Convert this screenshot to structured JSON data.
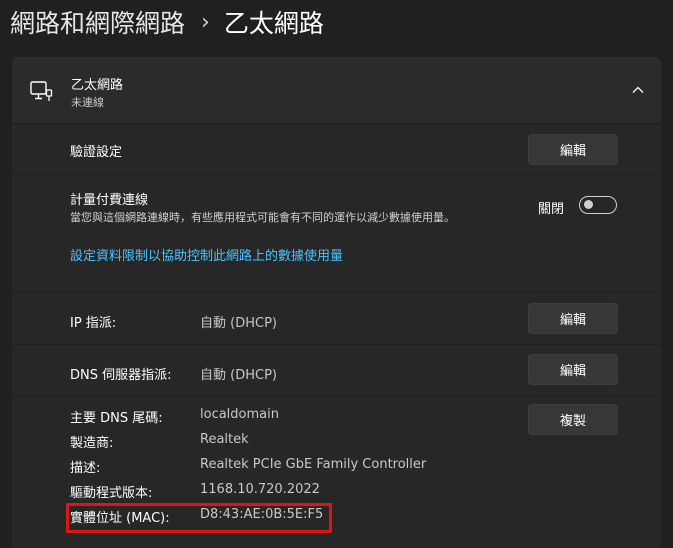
{
  "breadcrumb": {
    "parent": "網路和網際網路",
    "separator": "›",
    "current": "乙太網路"
  },
  "ethernet_header": {
    "title": "乙太網路",
    "status": "未連線"
  },
  "auth_settings": {
    "label": "驗證設定",
    "button": "編輯"
  },
  "metered": {
    "label": "計量付費連線",
    "description": "當您與這個網路連線時，有些應用程式可能會有不同的運作以減少數據使用量。",
    "toggle_label": "關閉",
    "toggle_on": false,
    "link": "設定資料限制以協助控制此網路上的數據使用量"
  },
  "ip_assignment": {
    "label": "IP 指派:",
    "value": "自動 (DHCP)",
    "button": "編輯"
  },
  "dns_assignment": {
    "label": "DNS 伺服器指派:",
    "value": "自動 (DHCP)",
    "button": "編輯"
  },
  "properties": {
    "copy_button": "複製",
    "items": [
      {
        "label": "主要 DNS 尾碼:",
        "value": "localdomain"
      },
      {
        "label": "製造商:",
        "value": "Realtek"
      },
      {
        "label": "描述:",
        "value": "Realtek PCIe GbE Family Controller"
      },
      {
        "label": "驅動程式版本:",
        "value": "1168.10.720.2022"
      },
      {
        "label": "實體位址 (MAC):",
        "value": "D8:43:AE:0B:5E:F5"
      }
    ]
  },
  "colors": {
    "background": "#202020",
    "card": "#2b2b2b",
    "link": "#4cc2ff",
    "highlight": "#e01414"
  }
}
